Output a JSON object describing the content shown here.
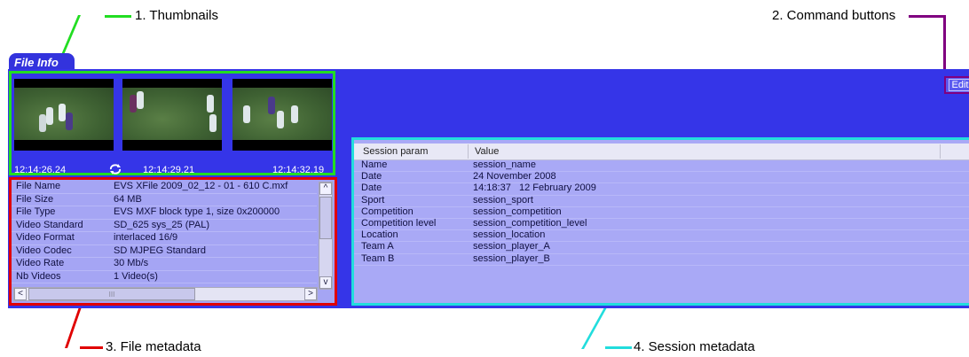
{
  "callouts": {
    "thumbnails": "1. Thumbnails",
    "command_buttons": "2. Command buttons",
    "file_metadata": "3. File metadata",
    "session_metadata": "4. Session metadata"
  },
  "colors": {
    "panel": "#3535e8",
    "thumbnails_outline": "#22dd22",
    "command_outline": "#800080",
    "file_outline": "#e00000",
    "session_outline": "#22dddd"
  },
  "tab": {
    "label": "File Info"
  },
  "commands": {
    "edit_label": "Edit"
  },
  "thumbnails": {
    "times": [
      "12:14:26.24",
      "12:14:29.21",
      "12:14:32.19"
    ],
    "sync_icon": "sync-icon"
  },
  "file_metadata": {
    "rows": [
      {
        "key": "File Name",
        "value": "EVS XFile 2009_02_12 - 01 - 610 C.mxf"
      },
      {
        "key": "File Size",
        "value": "64 MB"
      },
      {
        "key": "File Type",
        "value": "EVS MXF block type 1, size 0x200000"
      },
      {
        "key": "Video Standard",
        "value": "SD_625 sys_25 (PAL)"
      },
      {
        "key": "Video Format",
        "value": "interlaced 16/9"
      },
      {
        "key": "Video Codec",
        "value": "SD MJPEG Standard"
      },
      {
        "key": "Video Rate",
        "value": "30 Mb/s"
      },
      {
        "key": "Nb Videos",
        "value": "1 Video(s)"
      }
    ],
    "scroll_up": "^",
    "scroll_down": "v",
    "scroll_left": "<",
    "scroll_right": ">",
    "hscroll_grip": "III"
  },
  "session_metadata": {
    "header_param": "Session param",
    "header_value": "Value",
    "rows": [
      {
        "key": "Name",
        "value": "session_name"
      },
      {
        "key": "Date",
        "value": "24 November 2008"
      },
      {
        "key": "Date",
        "value": "14:18:37   12 February 2009"
      },
      {
        "key": "Sport",
        "value": "session_sport"
      },
      {
        "key": "Competition",
        "value": "session_competition"
      },
      {
        "key": "Competition level",
        "value": "session_competition_level"
      },
      {
        "key": "Location",
        "value": "session_location"
      },
      {
        "key": "Team A",
        "value": "session_player_A"
      },
      {
        "key": "Team B",
        "value": "session_player_B"
      }
    ]
  }
}
